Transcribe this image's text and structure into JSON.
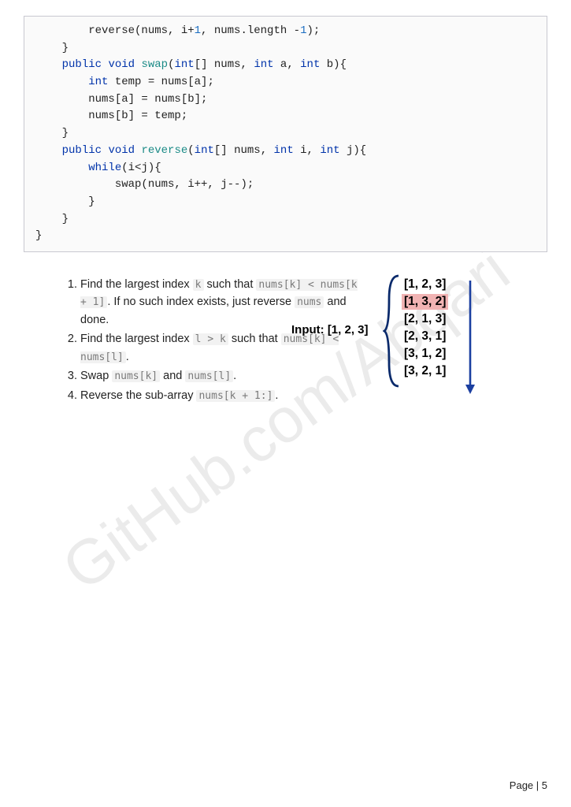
{
  "watermark": "GitHub.com/Abqari",
  "code": {
    "l1a": "        reverse(nums, i+",
    "l1num": "1",
    "l1b": ", nums.length -",
    "l1num2": "1",
    "l1c": ");",
    "l2": "    }",
    "l3a": "    ",
    "l3kw1": "public",
    "l3b": " ",
    "l3kw2": "void",
    "l3c": " ",
    "l3fn": "swap",
    "l3d": "(",
    "l3kw3": "int",
    "l3e": "[] nums, ",
    "l3kw4": "int",
    "l3f": " a, ",
    "l3kw5": "int",
    "l3g": " b){",
    "l4a": "        ",
    "l4kw": "int",
    "l4b": " temp = nums[a];",
    "l5": "        nums[a] = nums[b];",
    "l6": "        nums[b] = temp;",
    "l7": "    }",
    "l8a": "    ",
    "l8kw1": "public",
    "l8b": " ",
    "l8kw2": "void",
    "l8c": " ",
    "l8fn": "reverse",
    "l8d": "(",
    "l8kw3": "int",
    "l8e": "[] nums, ",
    "l8kw4": "int",
    "l8f": " i, ",
    "l8kw5": "int",
    "l8g": " j){",
    "l9a": "        ",
    "l9kw": "while",
    "l9b": "(i<j){",
    "l10": "            swap(nums, i++, j--);",
    "l11": "        }",
    "l12": "    }",
    "l13": "}"
  },
  "steps": {
    "s1a": "Find the largest index ",
    "s1code1": "k",
    "s1b": " such that ",
    "s1code2": "nums[k] < nums[k + 1]",
    "s1c": ". If no such index exists, just reverse ",
    "s1code3": "nums",
    "s1d": " and done.",
    "s2a": "Find the largest index ",
    "s2code1": "l > k",
    "s2b": " such that ",
    "s2code2": "nums[k] < nums[l]",
    "s2c": ".",
    "s3a": "Swap ",
    "s3code1": "nums[k]",
    "s3b": " and ",
    "s3code2": "nums[l]",
    "s3c": ".",
    "s4a": "Reverse the sub-array ",
    "s4code1": "nums[k + 1:]",
    "s4b": "."
  },
  "diagram": {
    "input_label": "Input: [1, 2, 3]",
    "permutations": [
      "[1, 2, 3]",
      "[1, 3, 2]",
      "[2, 1, 3]",
      "[2, 3, 1]",
      "[3, 1, 2]",
      "[3, 2, 1]"
    ],
    "highlight_index": 1
  },
  "footer": "Page | 5"
}
